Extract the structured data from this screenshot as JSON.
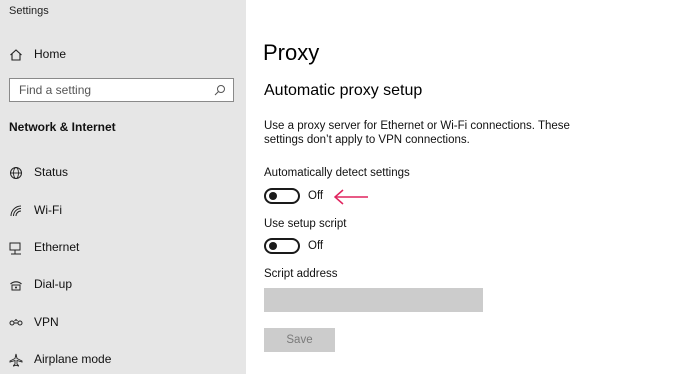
{
  "window": {
    "title": "Settings"
  },
  "sidebar": {
    "home_label": "Home",
    "search_placeholder": "Find a setting",
    "section_title": "Network & Internet",
    "items": [
      {
        "label": "Status",
        "icon": "globe-icon"
      },
      {
        "label": "Wi-Fi",
        "icon": "wifi-icon"
      },
      {
        "label": "Ethernet",
        "icon": "ethernet-icon"
      },
      {
        "label": "Dial-up",
        "icon": "dialup-icon"
      },
      {
        "label": "VPN",
        "icon": "vpn-icon"
      },
      {
        "label": "Airplane mode",
        "icon": "airplane-icon"
      }
    ]
  },
  "main": {
    "title": "Proxy",
    "subtitle": "Automatic proxy setup",
    "description": "Use a proxy server for Ethernet or Wi-Fi connections. These settings don’t apply to VPN connections.",
    "auto_detect": {
      "label": "Automatically detect settings",
      "state": "Off"
    },
    "setup_script": {
      "label": "Use setup script",
      "state": "Off"
    },
    "script_address": {
      "label": "Script address",
      "value": ""
    },
    "save_label": "Save"
  },
  "colors": {
    "sidebar_bg": "#e6e6e6",
    "arrow": "#e0245e",
    "disabled_bg": "#cccccc"
  }
}
